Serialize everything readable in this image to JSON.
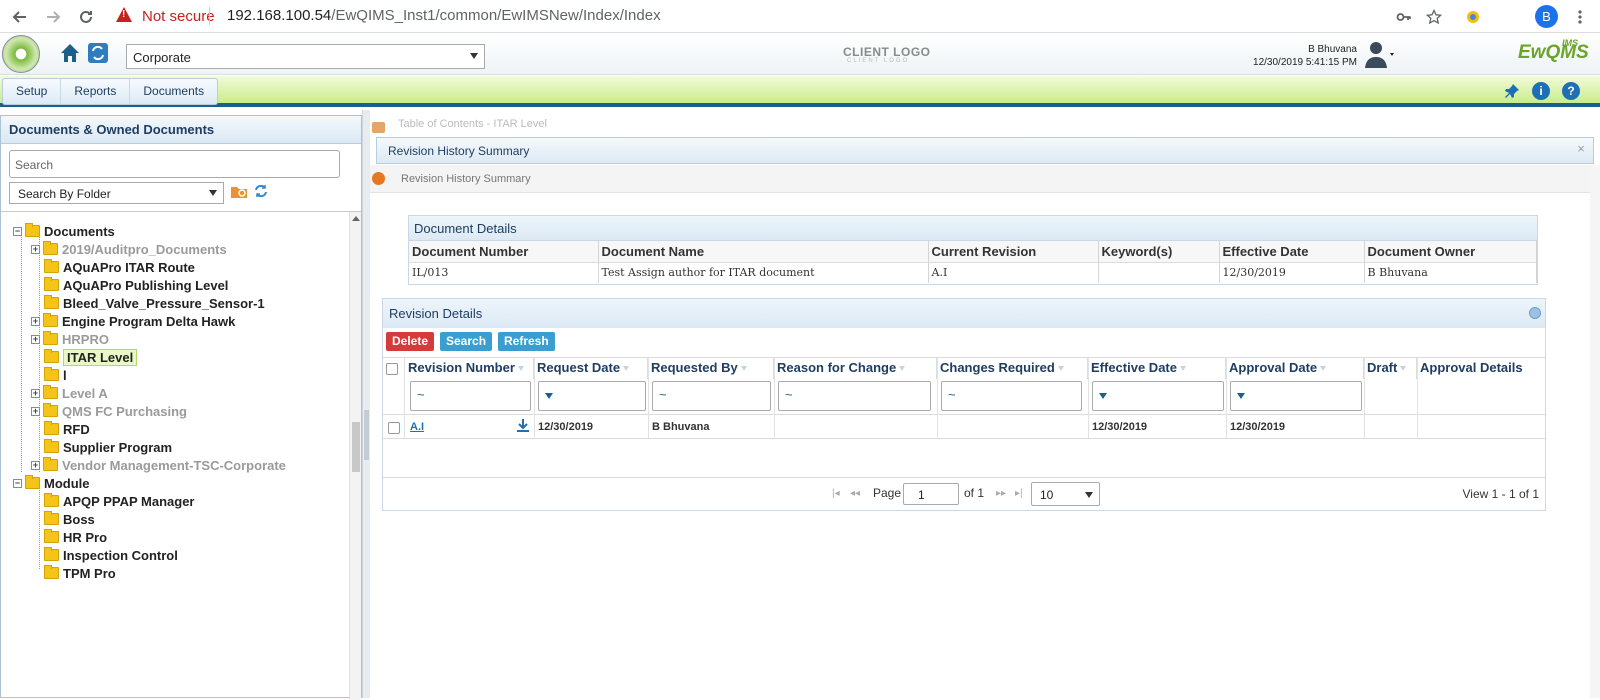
{
  "browser": {
    "not_secure": "Not secure",
    "url_host": "192.168.100.54",
    "url_path": "/EwQIMS_Inst1/common/EwIMSNew/Index/Index",
    "profile_initial": "B"
  },
  "header": {
    "organization": "Corporate",
    "client_logo": "CLIENT LOGO",
    "client_logo_sub": "CLIENT LOGO",
    "user_name": "B Bhuvana",
    "datetime": "12/30/2019 5:41:15 PM",
    "brand": "EwQMS",
    "brand_sup": "IMS"
  },
  "menu": {
    "items": [
      "Setup",
      "Reports",
      "Documents"
    ]
  },
  "left_panel": {
    "title": "Documents & Owned Documents",
    "search_placeholder": "Search",
    "search_by": "Search By Folder",
    "tree": [
      {
        "label": "Documents",
        "level": 0,
        "expander": "-",
        "gray": false
      },
      {
        "label": "2019/Auditpro_Documents",
        "level": 1,
        "expander": "+",
        "gray": true
      },
      {
        "label": "AQuAPro ITAR Route",
        "level": 1,
        "expander": "",
        "gray": false
      },
      {
        "label": "AQuAPro Publishing Level",
        "level": 1,
        "expander": "",
        "gray": false
      },
      {
        "label": "Bleed_Valve_Pressure_Sensor-1",
        "level": 1,
        "expander": "",
        "gray": false
      },
      {
        "label": "Engine Program Delta Hawk",
        "level": 1,
        "expander": "+",
        "gray": false
      },
      {
        "label": "HRPRO",
        "level": 1,
        "expander": "+",
        "gray": true
      },
      {
        "label": "ITAR Level",
        "level": 1,
        "expander": "",
        "gray": false,
        "selected": true
      },
      {
        "label": "l",
        "level": 1,
        "expander": "",
        "gray": false
      },
      {
        "label": "Level A",
        "level": 1,
        "expander": "+",
        "gray": true
      },
      {
        "label": "QMS FC Purchasing",
        "level": 1,
        "expander": "+",
        "gray": true
      },
      {
        "label": "RFD",
        "level": 1,
        "expander": "",
        "gray": false
      },
      {
        "label": "Supplier Program",
        "level": 1,
        "expander": "",
        "gray": false
      },
      {
        "label": "Vendor Management-TSC-Corporate",
        "level": 1,
        "expander": "+",
        "gray": true
      },
      {
        "label": "Module",
        "level": 0,
        "expander": "-",
        "gray": false
      },
      {
        "label": "APQP PPAP Manager",
        "level": 1,
        "expander": "",
        "gray": false
      },
      {
        "label": "Boss",
        "level": 1,
        "expander": "",
        "gray": false
      },
      {
        "label": "HR Pro",
        "level": 1,
        "expander": "",
        "gray": false
      },
      {
        "label": "Inspection Control",
        "level": 1,
        "expander": "",
        "gray": false
      },
      {
        "label": "TPM Pro",
        "level": 1,
        "expander": "",
        "gray": false
      }
    ]
  },
  "right_panel": {
    "background_breadcrumb": "Table of Contents - ITAR Level",
    "modal_title": "Revision History Summary",
    "breadcrumb": "Revision History Summary",
    "document_details": {
      "title": "Document Details",
      "headers": [
        "Document Number",
        "Document Name",
        "Current Revision",
        "Keyword(s)",
        "Effective Date",
        "Document Owner"
      ],
      "row": [
        "IL/013",
        "Test Assign author for ITAR document",
        "A.I",
        "",
        "12/30/2019",
        "B Bhuvana"
      ]
    },
    "revision_details": {
      "title": "Revision Details",
      "buttons": {
        "delete": "Delete",
        "search": "Search",
        "refresh": "Refresh"
      },
      "headers": [
        "Revision Number",
        "Request Date",
        "Requested By",
        "Reason for Change",
        "Changes Required",
        "Effective Date",
        "Approval Date",
        "Draft",
        "Approval Details"
      ],
      "filter_symbol": "~",
      "row": {
        "revision_number": "A.I",
        "request_date": "12/30/2019",
        "requested_by": "B Bhuvana",
        "reason": "",
        "changes": "",
        "effective_date": "12/30/2019",
        "approval_date": "12/30/2019",
        "draft": "",
        "approval_details": ""
      },
      "pager": {
        "page_label": "Page",
        "page": "1",
        "of": "of 1",
        "page_size": "10",
        "view": "View 1 - 1 of 1"
      }
    }
  }
}
